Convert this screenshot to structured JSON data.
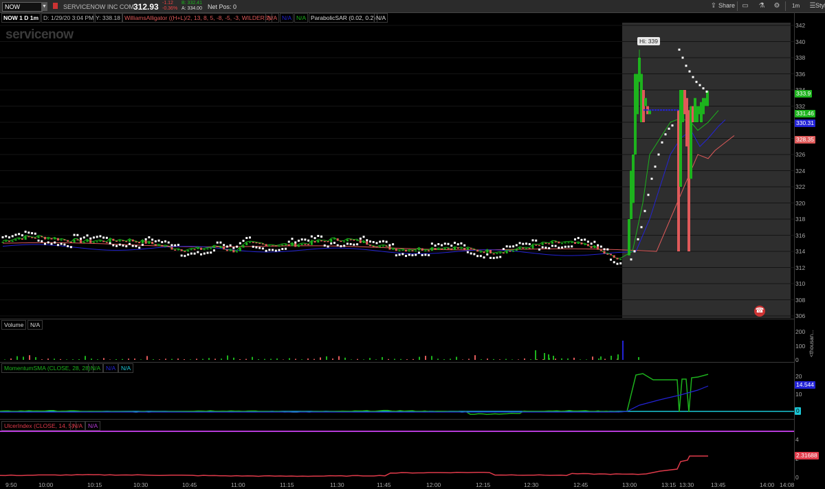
{
  "toolbar": {
    "symbol": "NOW",
    "company_name": "SERVICENOW INC COM",
    "last_price": "312.93",
    "change_abs": "-1.12",
    "change_pct": "-0.36%",
    "bid": "B: 332.41",
    "ask": "A: 334.00",
    "net_pos": "Net Pos: 0",
    "share_label": "Share",
    "timeframe": "1m",
    "style_label": "Style"
  },
  "study_bar": {
    "chart_id": "NOW 1 D 1m",
    "date_info": "D: 1/29/20 3:04 PM",
    "y_value": "Y: 338.18",
    "alligator": "WilliamsAlligator ((H+L)/2, 13, 8, 5, -8, -5, -3, WILDERS)",
    "na1": "N/A",
    "na2": "N/A",
    "na3": "N/A",
    "psar": "ParabolicSAR (0.02, 0.2)",
    "na4": "N/A"
  },
  "watermark": "servicenow",
  "hi_label": "Hi: 339",
  "price_axis": [
    "342",
    "340",
    "338",
    "336",
    "334",
    "332",
    "330",
    "328",
    "326",
    "324",
    "322",
    "320",
    "318",
    "316",
    "314",
    "312",
    "310",
    "308",
    "306"
  ],
  "price_tags": [
    {
      "text": "333.9",
      "color": "#1db31d"
    },
    {
      "text": "331.46",
      "color": "#1db31d"
    },
    {
      "text": "330.31",
      "color": "#2323d6"
    },
    {
      "text": "328.35",
      "color": "#e05a5a"
    }
  ],
  "volume_panel": {
    "label": "Volume",
    "na": "N/A",
    "axis": [
      "200",
      "100",
      "0"
    ],
    "unit": "<thousan..."
  },
  "momentum_panel": {
    "label": "MomentumSMA (CLOSE, 28, 28)",
    "na1": "N/A",
    "na2": "N/A",
    "na3": "N/A",
    "axis": [
      "20",
      "10"
    ],
    "tag1": "14.544",
    "tag2": "0"
  },
  "ulcer_panel": {
    "label": "UlcerIndex (CLOSE, 14, 5)",
    "na1": "N/A",
    "na2": "N/A",
    "axis": [
      "4",
      "2",
      "0"
    ],
    "tag": "2.31688"
  },
  "time_axis": [
    "9:50",
    "10:00",
    "10:15",
    "10:30",
    "10:45",
    "11:00",
    "11:15",
    "11:30",
    "11:45",
    "12:00",
    "12:15",
    "12:30",
    "12:45",
    "13:00",
    "13:15",
    "13:30",
    "13:45",
    "14:00",
    "14:08"
  ],
  "colors": {
    "up": "#1db31d",
    "down": "#e05a5a",
    "sar": "#ffffff",
    "jaw": "#e05a5a",
    "teeth": "#2323d6",
    "lips": "#1db31d"
  }
}
